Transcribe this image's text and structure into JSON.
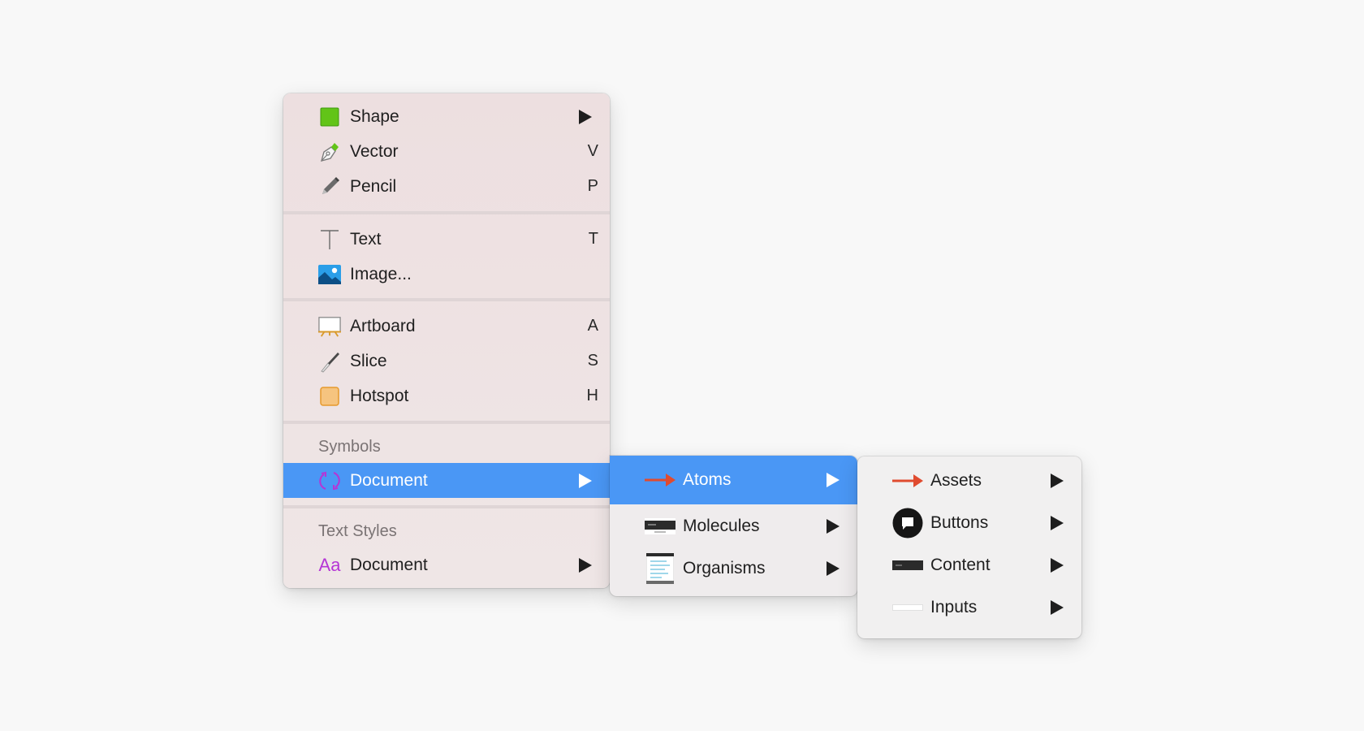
{
  "main_menu": {
    "items": [
      {
        "label": "Shape",
        "shortcut": "",
        "icon": "shape-icon"
      },
      {
        "label": "Vector",
        "shortcut": "V",
        "icon": "pen-icon"
      },
      {
        "label": "Pencil",
        "shortcut": "P",
        "icon": "pencil-icon"
      },
      {
        "label": "Text",
        "shortcut": "T",
        "icon": "text-cursor-icon"
      },
      {
        "label": "Image...",
        "shortcut": "",
        "icon": "image-icon"
      },
      {
        "label": "Artboard",
        "shortcut": "A",
        "icon": "easel-icon"
      },
      {
        "label": "Slice",
        "shortcut": "S",
        "icon": "knife-icon"
      },
      {
        "label": "Hotspot",
        "shortcut": "H",
        "icon": "hotspot-icon"
      }
    ],
    "symbols_header": "Symbols",
    "symbols_document": {
      "label": "Document",
      "icon": "symbol-sync-icon"
    },
    "text_styles_header": "Text Styles",
    "text_styles_document": {
      "label": "Document",
      "icon": "text-style-icon",
      "glyph": "Aa"
    }
  },
  "submenu_symbols": {
    "items": [
      {
        "label": "Atoms",
        "icon": "red-arrow-icon"
      },
      {
        "label": "Molecules",
        "icon": "molecule-thumbnail-icon"
      },
      {
        "label": "Organisms",
        "icon": "organism-thumbnail-icon"
      }
    ]
  },
  "submenu_atoms": {
    "items": [
      {
        "label": "Assets",
        "icon": "red-arrow-icon"
      },
      {
        "label": "Buttons",
        "icon": "chat-bubble-icon"
      },
      {
        "label": "Content",
        "icon": "content-bar-icon"
      },
      {
        "label": "Inputs",
        "icon": "input-field-icon"
      }
    ]
  },
  "colors": {
    "selected": "#4a97f5",
    "shape": "#62c418",
    "hotspot": "#f6c47f",
    "symbol": "#b535d6",
    "arrow": "#e04b2f"
  }
}
